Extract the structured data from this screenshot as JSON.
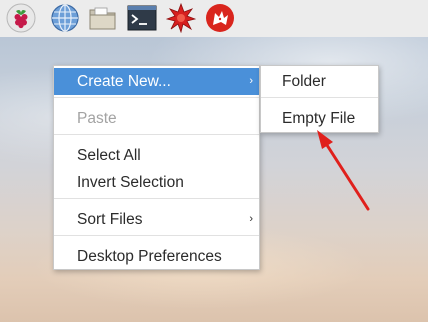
{
  "taskbar": {
    "launchers": [
      {
        "icon": "raspberry-menu-icon"
      },
      {
        "icon": "web-browser-icon"
      },
      {
        "icon": "file-manager-icon"
      },
      {
        "icon": "terminal-icon"
      },
      {
        "icon": "mathematica-icon"
      },
      {
        "icon": "wolfram-icon"
      }
    ]
  },
  "context_menu": {
    "items": [
      {
        "label": "Create New...",
        "state": "highlighted",
        "has_submenu": true
      },
      {
        "label": "Paste",
        "state": "disabled"
      },
      {
        "label": "Select All"
      },
      {
        "label": "Invert Selection"
      },
      {
        "label": "Sort Files",
        "has_submenu": true
      },
      {
        "label": "Desktop Preferences"
      }
    ],
    "submenu_arrow": "›"
  },
  "submenu": {
    "items": [
      {
        "label": "Folder"
      },
      {
        "label": "Empty File"
      }
    ]
  },
  "colors": {
    "highlight": "#4a90d9",
    "annotation_arrow": "#e0201c",
    "disabled_text": "#a3a3a3"
  }
}
